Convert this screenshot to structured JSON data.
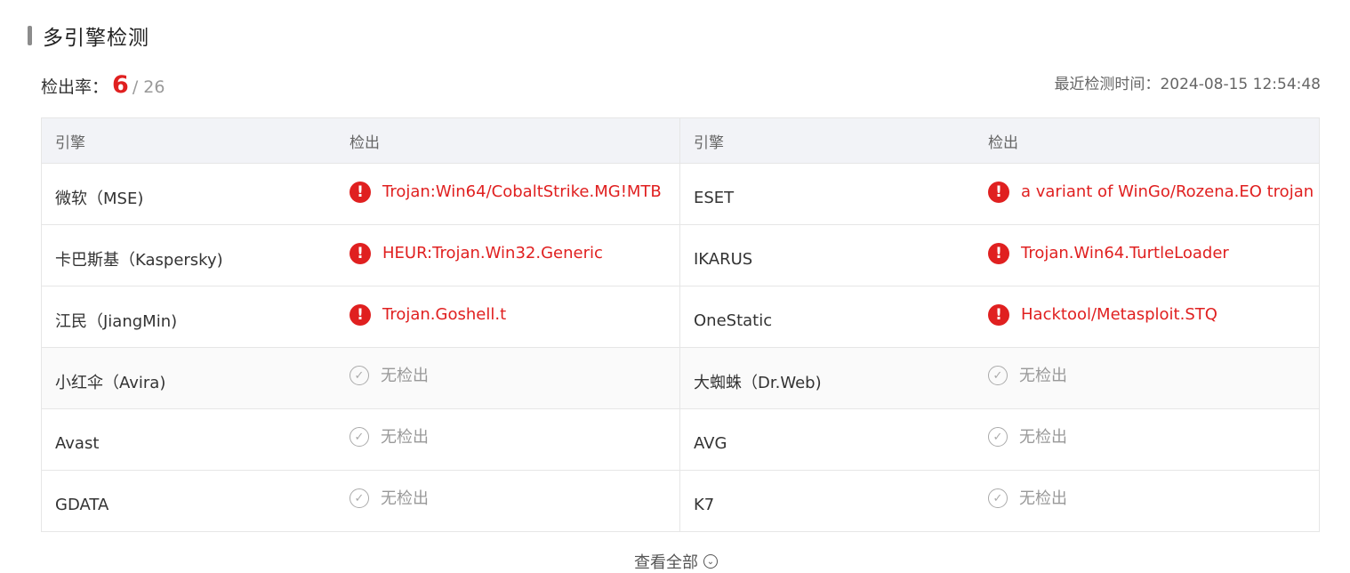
{
  "section": {
    "title": "多引擎检测"
  },
  "rate": {
    "label": "检出率：",
    "detected": "6",
    "total": "/ 26"
  },
  "scan_time": {
    "label": "最近检测时间：",
    "value": "2024-08-15 12:54:48"
  },
  "table": {
    "headers": [
      "引擎",
      "检出",
      "引擎",
      "检出"
    ],
    "rows": [
      {
        "left": {
          "engine": "微软（MSE)",
          "result": "Trojan:Win64/CobaltStrike.MG!MTB",
          "detected": true
        },
        "right": {
          "engine": "ESET",
          "result": "a variant of WinGo/Rozena.EO trojan",
          "detected": true
        }
      },
      {
        "left": {
          "engine": "卡巴斯基（Kaspersky)",
          "result": "HEUR:Trojan.Win32.Generic",
          "detected": true
        },
        "right": {
          "engine": "IKARUS",
          "result": "Trojan.Win64.TurtleLoader",
          "detected": true
        }
      },
      {
        "left": {
          "engine": "江民（JiangMin)",
          "result": "Trojan.Goshell.t",
          "detected": true
        },
        "right": {
          "engine": "OneStatic",
          "result": "Hacktool/Metasploit.STQ",
          "detected": true
        }
      },
      {
        "left": {
          "engine": "小红伞（Avira)",
          "result": "无检出",
          "detected": false
        },
        "right": {
          "engine": "大蜘蛛（Dr.Web)",
          "result": "无检出",
          "detected": false
        }
      },
      {
        "left": {
          "engine": "Avast",
          "result": "无检出",
          "detected": false
        },
        "right": {
          "engine": "AVG",
          "result": "无检出",
          "detected": false
        }
      },
      {
        "left": {
          "engine": "GDATA",
          "result": "无检出",
          "detected": false
        },
        "right": {
          "engine": "K7",
          "result": "无检出",
          "detected": false
        }
      }
    ]
  },
  "view_all": {
    "label": "查看全部"
  },
  "colors": {
    "threat": "#e02020",
    "clean": "#999999",
    "header_bg": "#f2f3f7"
  },
  "icons": {
    "threat": "exclamation-circle-icon",
    "clean": "check-circle-icon",
    "expand": "chevron-down-icon"
  }
}
